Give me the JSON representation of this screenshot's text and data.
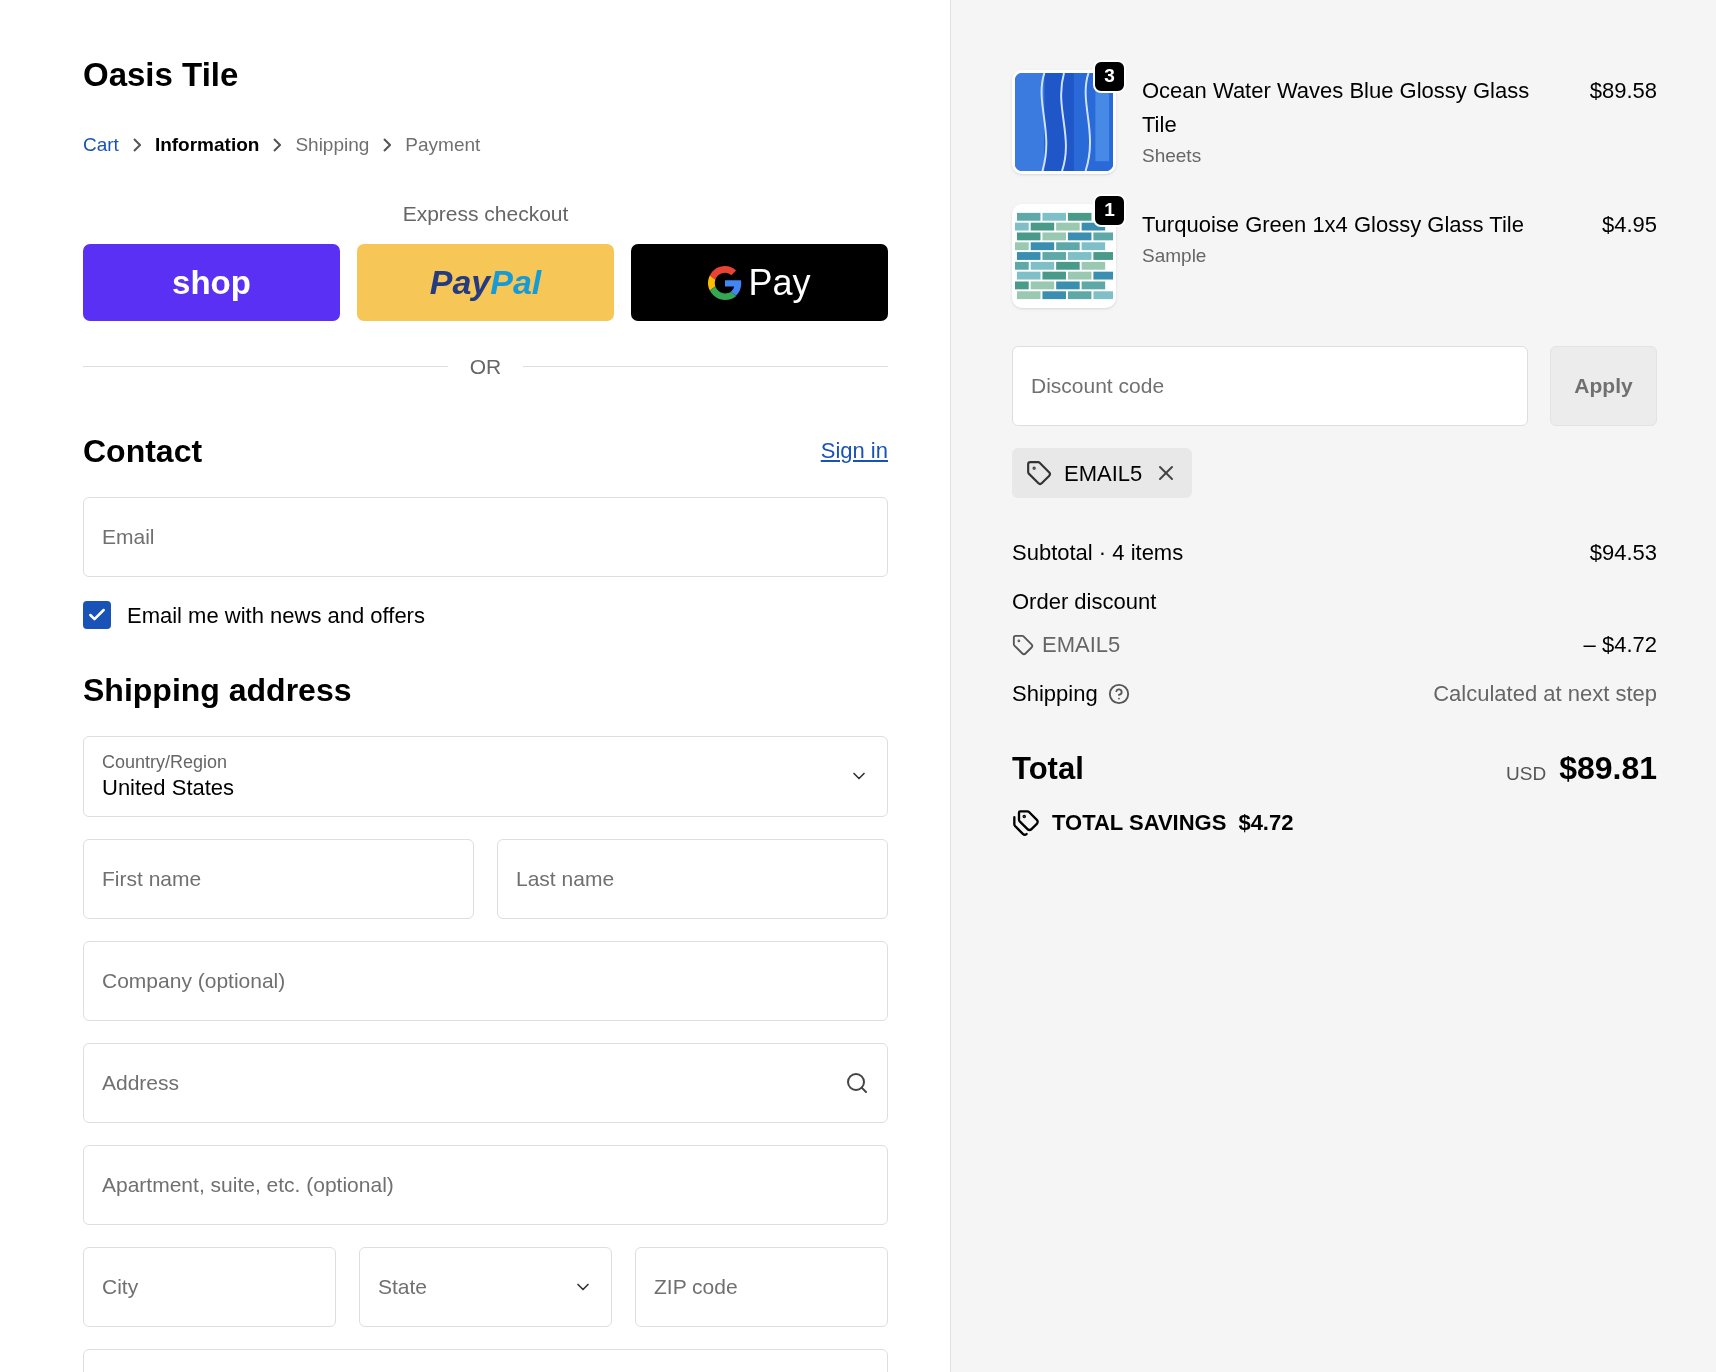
{
  "store": {
    "name": "Oasis Tile"
  },
  "breadcrumb": [
    {
      "label": "Cart",
      "kind": "link"
    },
    {
      "label": "Information",
      "kind": "current"
    },
    {
      "label": "Shipping",
      "kind": "upcoming"
    },
    {
      "label": "Payment",
      "kind": "upcoming"
    }
  ],
  "express_checkout": {
    "title": "Express checkout",
    "buttons": [
      {
        "kind": "shop",
        "label": "shop"
      },
      {
        "kind": "paypal",
        "label": "Pay",
        "label_2": "Pal"
      },
      {
        "kind": "gpay",
        "label": "Pay"
      }
    ]
  },
  "divider": "OR",
  "contact": {
    "title": "Contact",
    "sign_in": "Sign in",
    "email": {
      "placeholder": "Email"
    },
    "newsletter": {
      "label": "Email me with news and offers",
      "checked": true
    }
  },
  "shipping_address": {
    "title": "Shipping address",
    "country": {
      "label": "Country/Region",
      "value": "United States"
    },
    "rows": [
      [
        {
          "placeholder": "First name",
          "kind": "text"
        },
        {
          "placeholder": "Last name",
          "kind": "text"
        }
      ],
      [
        {
          "placeholder": "Company (optional)",
          "kind": "text"
        }
      ],
      [
        {
          "placeholder": "Address",
          "kind": "search"
        }
      ],
      [
        {
          "placeholder": "Apartment, suite, etc. (optional)",
          "kind": "text"
        }
      ],
      [
        {
          "placeholder": "City",
          "kind": "text"
        },
        {
          "placeholder": "State",
          "kind": "select"
        },
        {
          "placeholder": "ZIP code",
          "kind": "text"
        }
      ]
    ]
  },
  "order": {
    "items": [
      {
        "title": "Ocean Water Waves Blue Glossy Glass Tile",
        "variant": "Sheets",
        "price": "$89.58",
        "quantity": "3"
      },
      {
        "title": "Turquoise Green 1x4 Glossy Glass Tile",
        "variant": "Sample",
        "price": "$4.95",
        "quantity": "1"
      }
    ],
    "discount": {
      "placeholder": "Discount code",
      "button": "Apply"
    },
    "applied_codes": [
      {
        "code": "EMAIL5"
      }
    ],
    "subtotal": {
      "label": "Subtotal · 4 items",
      "value": "$94.53"
    },
    "order_discount": {
      "label": "Order discount",
      "code": "EMAIL5",
      "value": "– $4.72"
    },
    "shipping": {
      "label": "Shipping",
      "value": "Calculated at next step"
    },
    "total": {
      "label": "Total",
      "currency": "USD",
      "value": "$89.81"
    },
    "savings": {
      "label": "TOTAL SAVINGS",
      "value": "$4.72"
    }
  }
}
